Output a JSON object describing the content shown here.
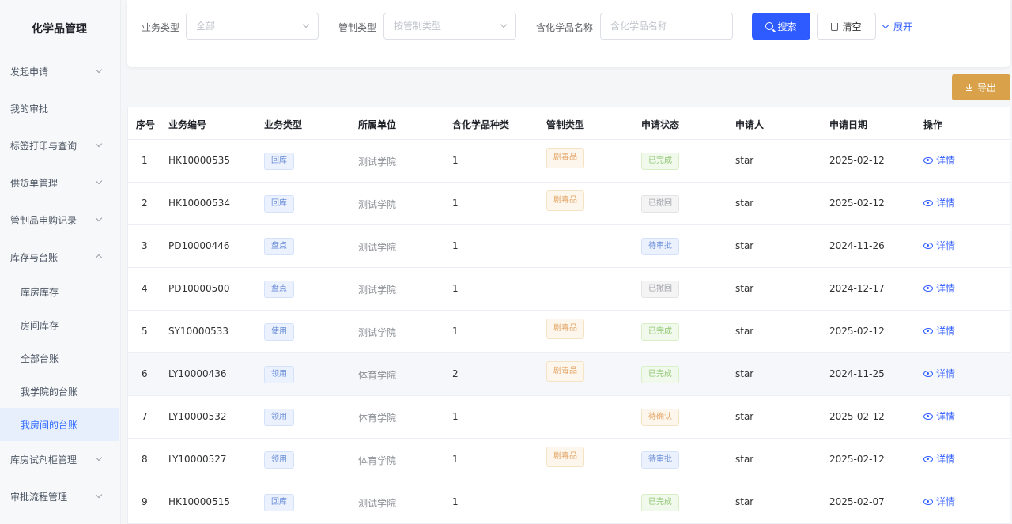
{
  "app": {
    "title": "化学品管理"
  },
  "sidebar": {
    "items": [
      {
        "label": "发起申请",
        "chevron": "down"
      },
      {
        "label": "我的审批",
        "chevron": ""
      },
      {
        "label": "标签打印与查询",
        "chevron": "down"
      },
      {
        "label": "供货单管理",
        "chevron": "down"
      },
      {
        "label": "管制品申购记录",
        "chevron": "down"
      },
      {
        "label": "库存与台账",
        "chevron": "up"
      },
      {
        "label": "库房库存",
        "sub": true
      },
      {
        "label": "房间库存",
        "sub": true
      },
      {
        "label": "全部台账",
        "sub": true
      },
      {
        "label": "我学院的台账",
        "sub": true
      },
      {
        "label": "我房间的台账",
        "sub": true,
        "active": true
      },
      {
        "label": "库房试剂柜管理",
        "chevron": "down"
      },
      {
        "label": "审批流程管理",
        "chevron": "down"
      }
    ]
  },
  "filters": {
    "business_type_label": "业务类型",
    "business_type_value": "全部",
    "control_type_label": "管制类型",
    "control_type_placeholder": "按管制类型",
    "chemical_name_label": "含化学品名称",
    "chemical_name_placeholder": "含化学品名称",
    "search_label": "搜索",
    "clear_label": "清空",
    "expand_label": "展开"
  },
  "toolbar": {
    "export_label": "导出"
  },
  "table": {
    "columns": [
      "序号",
      "业务编号",
      "业务类型",
      "所属单位",
      "含化学品种类",
      "管制类型",
      "申请状态",
      "申请人",
      "申请日期",
      "操作"
    ],
    "action_label": "详情",
    "rows": [
      {
        "index": "1",
        "code": "HK10000535",
        "type": "回库",
        "unit": "测试学院",
        "kinds": "1",
        "control": "剧毒品",
        "status": "已完成",
        "status_kind": "done",
        "applicant": "star",
        "date": "2025-02-12"
      },
      {
        "index": "2",
        "code": "HK10000534",
        "type": "回库",
        "unit": "测试学院",
        "kinds": "1",
        "control": "剧毒品",
        "status": "已撤回",
        "status_kind": "cancel",
        "applicant": "star",
        "date": "2025-02-12"
      },
      {
        "index": "3",
        "code": "PD10000446",
        "type": "盘点",
        "unit": "测试学院",
        "kinds": "1",
        "control": "",
        "status": "待审批",
        "status_kind": "pending",
        "applicant": "star",
        "date": "2024-11-26"
      },
      {
        "index": "4",
        "code": "PD10000500",
        "type": "盘点",
        "unit": "测试学院",
        "kinds": "1",
        "control": "",
        "status": "已撤回",
        "status_kind": "cancel",
        "applicant": "star",
        "date": "2024-12-17"
      },
      {
        "index": "5",
        "code": "SY10000533",
        "type": "使用",
        "unit": "测试学院",
        "kinds": "1",
        "control": "剧毒品",
        "status": "已完成",
        "status_kind": "done",
        "applicant": "star",
        "date": "2025-02-12"
      },
      {
        "index": "6",
        "code": "LY10000436",
        "type": "领用",
        "unit": "体育学院",
        "kinds": "2",
        "control": "剧毒品",
        "status": "已完成",
        "status_kind": "done",
        "applicant": "star",
        "date": "2024-11-25",
        "highlight": true
      },
      {
        "index": "7",
        "code": "LY10000532",
        "type": "领用",
        "unit": "体育学院",
        "kinds": "1",
        "control": "",
        "status": "待确认",
        "status_kind": "confirm",
        "applicant": "star",
        "date": "2025-02-12"
      },
      {
        "index": "8",
        "code": "LY10000527",
        "type": "领用",
        "unit": "体育学院",
        "kinds": "1",
        "control": "剧毒品",
        "status": "待审批",
        "status_kind": "pending",
        "applicant": "star",
        "date": "2025-02-12"
      },
      {
        "index": "9",
        "code": "HK10000515",
        "type": "回库",
        "unit": "测试学院",
        "kinds": "1",
        "control": "",
        "status": "已完成",
        "status_kind": "done",
        "applicant": "star",
        "date": "2025-02-07"
      }
    ]
  }
}
